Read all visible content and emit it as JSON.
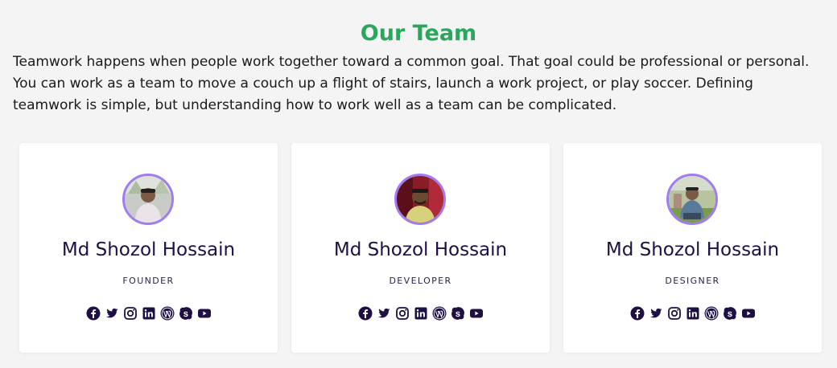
{
  "section": {
    "title": "Our Team",
    "intro": "Teamwork happens when people work together toward a common goal. That goal could be professional or personal. You can work as a team to move a couch up a flight of stairs, launch a work project, or play soccer. Defining teamwork is simple, but understanding how to work well as a team can be complicated."
  },
  "members": [
    {
      "name": "Md Shozol Hossain",
      "role": "FOUNDER"
    },
    {
      "name": "Md Shozol Hossain",
      "role": "DEVELOPER"
    },
    {
      "name": "Md Shozol Hossain",
      "role": "DESIGNER"
    }
  ],
  "social_icons": [
    "facebook-icon",
    "twitter-icon",
    "instagram-icon",
    "linkedin-icon",
    "wordpress-icon",
    "skype-icon",
    "youtube-icon"
  ],
  "colors": {
    "title": "#28a85b",
    "avatar_border": "#a07cf0",
    "name": "#1e0f45",
    "icon": "#1e0f45",
    "background": "#f4f4f4",
    "card": "#ffffff"
  }
}
